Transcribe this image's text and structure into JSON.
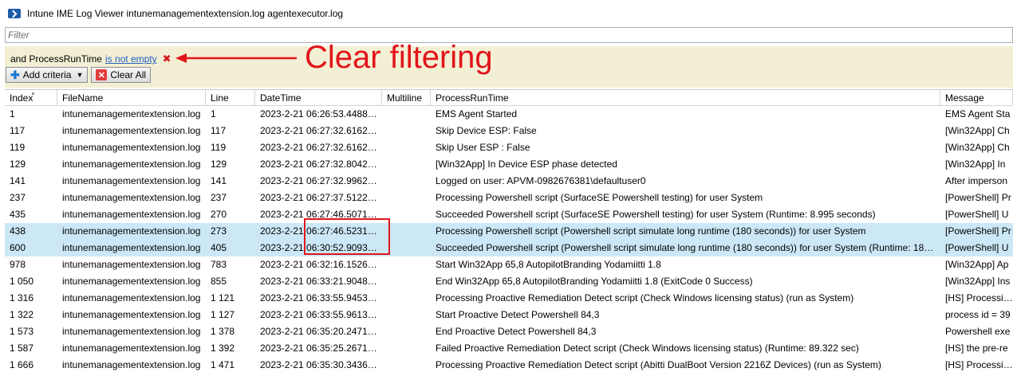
{
  "window": {
    "title": "Intune IME Log Viewer intunemanagementextension.log agentexecutor.log"
  },
  "filter": {
    "placeholder": "Filter",
    "value": ""
  },
  "criteria": {
    "prefix": "and ProcessRunTime",
    "condition_link": "is not empty",
    "remove_glyph": "✖",
    "add_label": "Add criteria",
    "clear_all_label": "Clear All"
  },
  "annotation": {
    "text": "Clear filtering",
    "color": "#e2141a"
  },
  "table": {
    "columns": [
      "Index",
      "FileName",
      "Line",
      "DateTime",
      "Multiline",
      "ProcessRunTime",
      "Message"
    ],
    "sorted_column": "Index",
    "selected_rows": [
      7,
      8
    ],
    "rows": [
      [
        "1",
        "intunemanagementextension.log",
        "1",
        "2023-2-21 06:26:53.4488693",
        "",
        "EMS Agent Started",
        "EMS Agent Sta"
      ],
      [
        "117",
        "intunemanagementextension.log",
        "117",
        "2023-2-21 06:27:32.6162224",
        "",
        "Skip Device ESP: False",
        "[Win32App] Ch"
      ],
      [
        "119",
        "intunemanagementextension.log",
        "119",
        "2023-2-21 06:27:32.6162224",
        "",
        "Skip User ESP  : False",
        "[Win32App] Ch"
      ],
      [
        "129",
        "intunemanagementextension.log",
        "129",
        "2023-2-21 06:27:32.8042223",
        "",
        "[Win32App] In Device ESP phase detected",
        "[Win32App] In"
      ],
      [
        "141",
        "intunemanagementextension.log",
        "141",
        "2023-2-21 06:27:32.9962237",
        "",
        "Logged on user: APVM-0982676381\\defaultuser0",
        "After imperson"
      ],
      [
        "237",
        "intunemanagementextension.log",
        "237",
        "2023-2-21 06:27:37.5122294",
        "",
        "Processing Powershell script (SurfaceSE Powershell testing) for user System",
        "[PowerShell] Pr"
      ],
      [
        "435",
        "intunemanagementextension.log",
        "270",
        "2023-2-21 06:27:46.5071444",
        "",
        "Succeeded Powershell script (SurfaceSE Powershell testing) for user System (Runtime: 8.995 seconds)",
        "[PowerShell] U"
      ],
      [
        "438",
        "intunemanagementextension.log",
        "273",
        "2023-2-21 06:27:46.5231452",
        "",
        "Processing Powershell script (Powershell script simulate long runtime (180 seconds)) for user System",
        "[PowerShell] Pr"
      ],
      [
        "600",
        "intunemanagementextension.log",
        "405",
        "2023-2-21 06:30:52.9093638",
        "",
        "Succeeded Powershell script (Powershell script simulate long runtime (180 seconds)) for user System (Runtime: 186.3...",
        "[PowerShell] U"
      ],
      [
        "978",
        "intunemanagementextension.log",
        "783",
        "2023-2-21 06:32:16.1526776",
        "",
        "Start Win32App       65,8    AutopilotBranding Yodamiitti 1.8",
        "[Win32App] Ap"
      ],
      [
        "1 050",
        "intunemanagementextension.log",
        "855",
        "2023-2-21 06:33:21.9048482",
        "",
        "End Win32App        65,8    AutopilotBranding Yodamiitti 1.8 (ExitCode 0 Success)",
        "[Win32App] Ins"
      ],
      [
        "1 316",
        "intunemanagementextension.log",
        "1 121",
        "2023-2-21 06:33:55.9453685",
        "",
        "Processing Proactive Remediation Detect script (Check Windows licensing status) (run as System)",
        "[HS] Processing"
      ],
      [
        "1 322",
        "intunemanagementextension.log",
        "1 127",
        "2023-2-21 06:33:55.9613688",
        "",
        "Start Proactive Detect Powershell       84,3",
        "process id = 39"
      ],
      [
        "1 573",
        "intunemanagementextension.log",
        "1 378",
        "2023-2-21 06:35:20.2471512",
        "",
        "End Proactive Detect Powershell      84,3",
        "Powershell exe"
      ],
      [
        "1 587",
        "intunemanagementextension.log",
        "1 392",
        "2023-2-21 06:35:25.2671972",
        "",
        "Failed Proactive Remediation Detect script (Check Windows licensing status) (Runtime: 89.322 sec)",
        "[HS] the pre-re"
      ],
      [
        "1 666",
        "intunemanagementextension.log",
        "1 471",
        "2023-2-21 06:35:30.3436615",
        "",
        "Processing Proactive Remediation Detect script (Abitti DualBoot Version 2216Z Devices) (run as System)",
        "[HS] Processing"
      ]
    ]
  }
}
